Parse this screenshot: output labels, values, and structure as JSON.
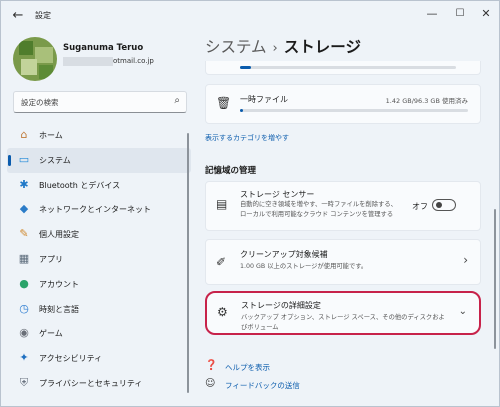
{
  "window": {
    "app_title": "設定",
    "back_glyph": "←",
    "minimize_glyph": "—",
    "maximize_glyph": "☐",
    "close_glyph": "✕"
  },
  "profile": {
    "name": "Suganuma Teruo",
    "email_visible": "otmail.co.jp"
  },
  "search": {
    "placeholder": "設定の検索",
    "icon": "search-icon"
  },
  "sidebar": {
    "items": [
      {
        "label": "ホーム",
        "icon": "home-icon",
        "glyph": "⌂",
        "color": "#c07a3a",
        "selected": false
      },
      {
        "label": "システム",
        "icon": "system-icon",
        "glyph": "▭",
        "color": "#1e88d8",
        "selected": true
      },
      {
        "label": "Bluetooth とデバイス",
        "icon": "bluetooth-icon",
        "glyph": "✱",
        "color": "#1e78c8",
        "selected": false
      },
      {
        "label": "ネットワークとインターネット",
        "icon": "wifi-icon",
        "glyph": "◆",
        "color": "#2b7cc8",
        "selected": false
      },
      {
        "label": "個人用設定",
        "icon": "brush-icon",
        "glyph": "✎",
        "color": "#d08a30",
        "selected": false
      },
      {
        "label": "アプリ",
        "icon": "apps-icon",
        "glyph": "▦",
        "color": "#5a6a7a",
        "selected": false
      },
      {
        "label": "アカウント",
        "icon": "account-icon",
        "glyph": "●",
        "color": "#2aa36a",
        "selected": false
      },
      {
        "label": "時刻と言語",
        "icon": "time-language-icon",
        "glyph": "◷",
        "color": "#2a7bd0",
        "selected": false
      },
      {
        "label": "ゲーム",
        "icon": "gaming-icon",
        "glyph": "◉",
        "color": "#6a6f78",
        "selected": false
      },
      {
        "label": "アクセシビリティ",
        "icon": "accessibility-icon",
        "glyph": "✦",
        "color": "#1e6fc0",
        "selected": false
      },
      {
        "label": "プライバシーとセキュリティ",
        "icon": "shield-icon",
        "glyph": "⛨",
        "color": "#6a7380",
        "selected": false
      }
    ]
  },
  "breadcrumb": {
    "parent": "システム",
    "separator": "›",
    "current": "ストレージ"
  },
  "storage": {
    "top_bar_fill": 0.05,
    "temp_files": {
      "title": "一時ファイル",
      "usage": "1.42 GB/96.3 GB 使用済み",
      "fill": 0.015,
      "icon": "trash-icon"
    },
    "more_categories_link": "表示するカテゴリを増やす"
  },
  "management": {
    "section_title": "記憶域の管理",
    "storage_sense": {
      "title": "ストレージ センサー",
      "description": "自動的に空き領域を増やす、一時ファイルを削除する、ローカルで利用可能なクラウド コンテンツを管理する",
      "toggle_label": "オフ",
      "toggle_on": false,
      "icon": "storage-drive-icon"
    },
    "cleanup": {
      "title": "クリーンアップ対象候補",
      "description": "1.00 GB 以上のストレージが使用可能です。",
      "icon": "broom-icon"
    },
    "advanced": {
      "title": "ストレージの詳細設定",
      "description": "バックアップ オプション、ストレージ スペース、その他のディスクおよびボリューム",
      "icon": "gear-icon"
    }
  },
  "footer_links": {
    "help": "ヘルプを表示",
    "feedback": "フィードバックの送信"
  }
}
